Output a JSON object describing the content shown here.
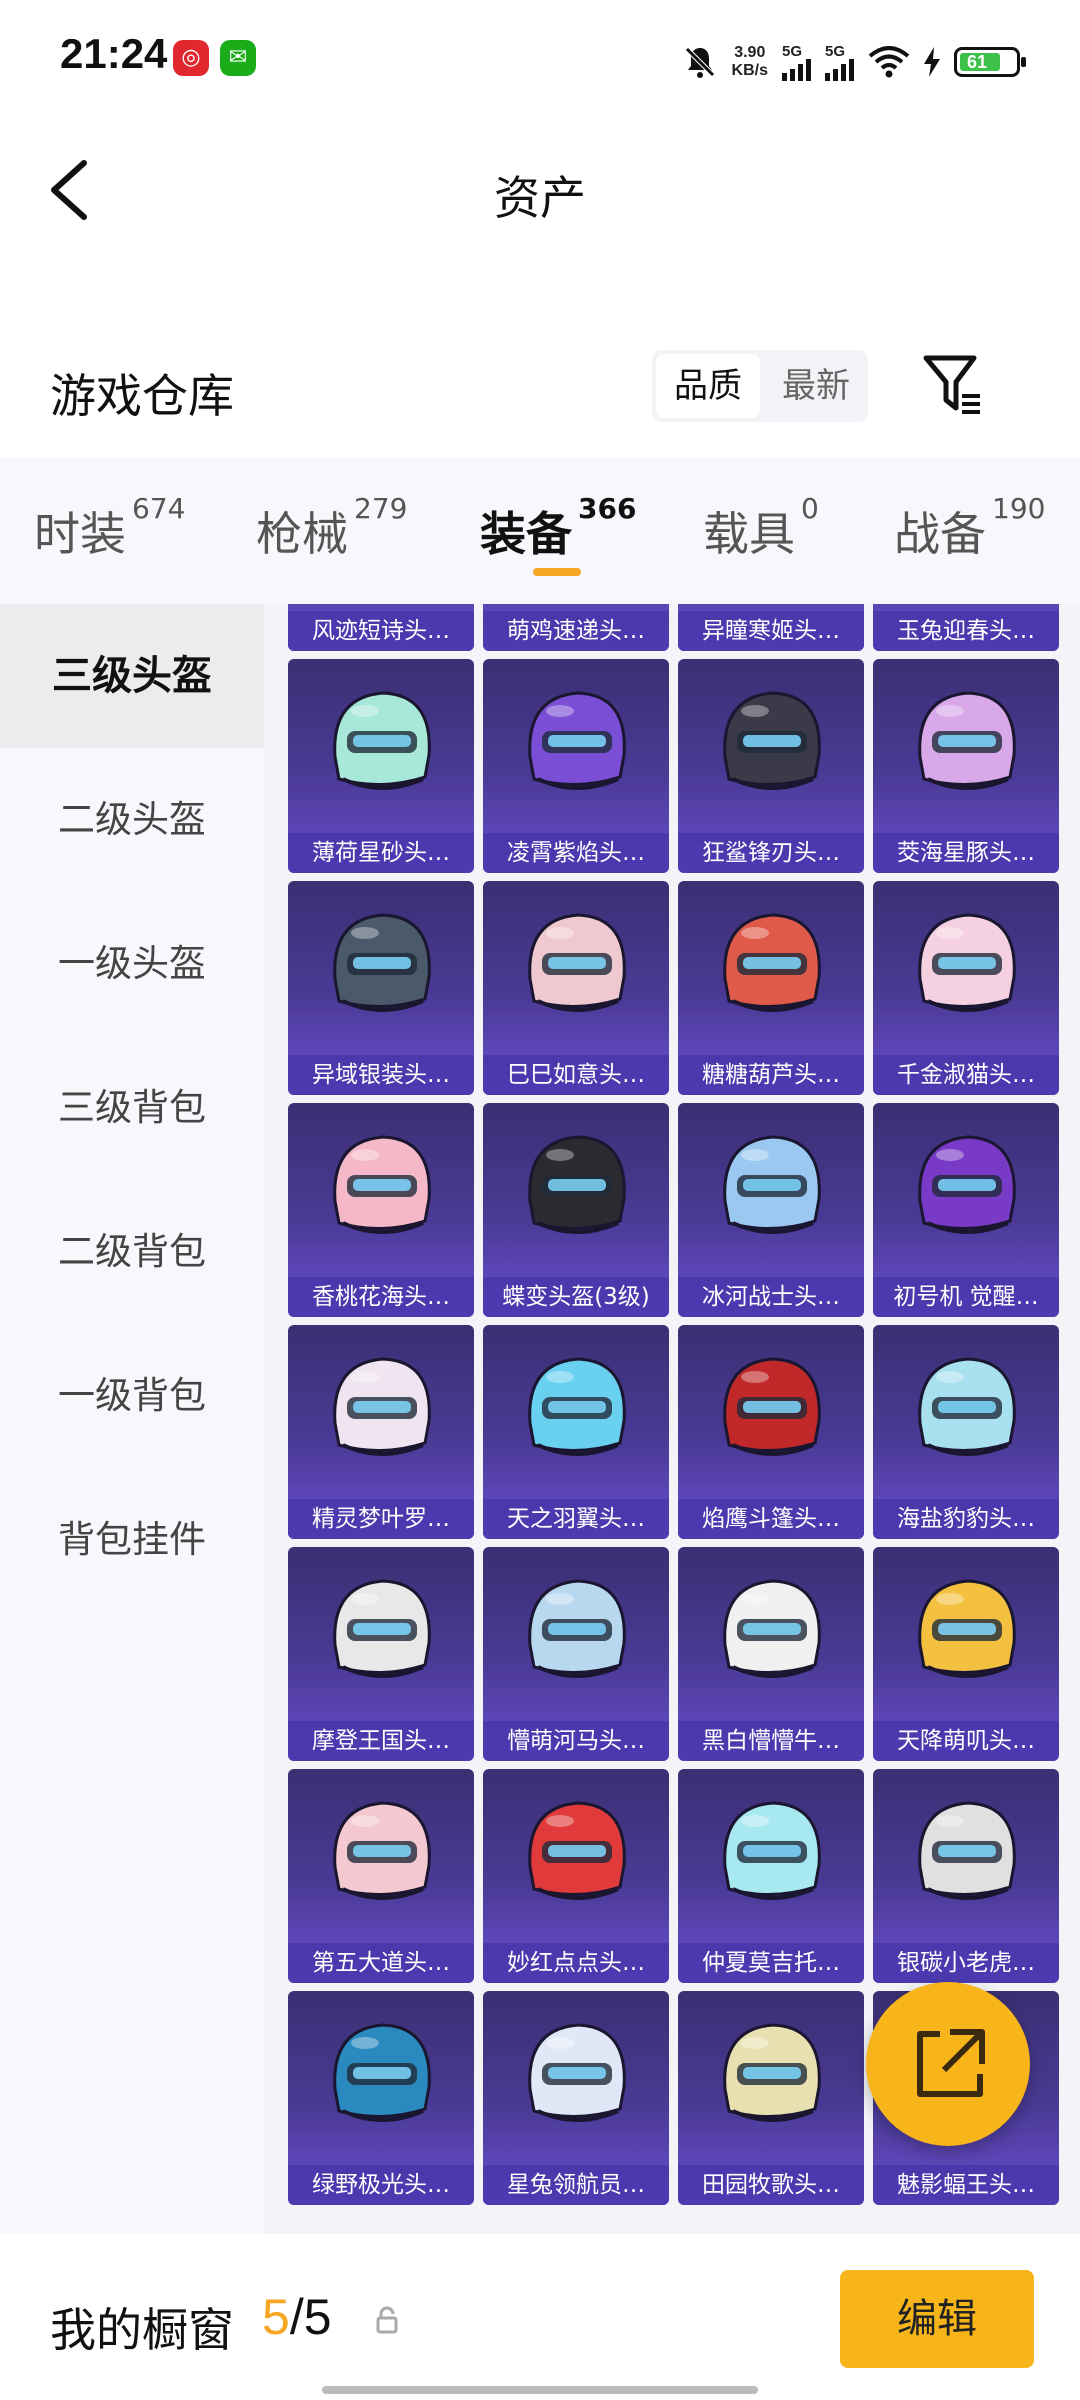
{
  "status_bar": {
    "time": "21:24",
    "net_speed_value": "3.90",
    "net_speed_unit": "KB/s",
    "signal1": "5G",
    "signal2": "5G",
    "battery": "61",
    "icons": [
      "netease-music-icon",
      "wechat-icon",
      "mute-bell-icon",
      "signal-icon",
      "signal-icon",
      "wifi-icon",
      "charging-icon",
      "battery-icon"
    ]
  },
  "header": {
    "title": "资产",
    "back_icon": "chevron-left-icon"
  },
  "warehouse": {
    "title": "游戏仓库",
    "sort": [
      "品质",
      "最新"
    ],
    "sort_active": "品质",
    "filter_icon": "filter-icon"
  },
  "tabs": [
    {
      "label": "时装",
      "count": "674"
    },
    {
      "label": "枪械",
      "count": "279"
    },
    {
      "label": "装备",
      "count": "366"
    },
    {
      "label": "载具",
      "count": "0"
    },
    {
      "label": "战备",
      "count": "190"
    }
  ],
  "tab_active": "装备",
  "sidebar": [
    "三级头盔",
    "二级头盔",
    "一级头盔",
    "三级背包",
    "二级背包",
    "一级背包",
    "背包挂件"
  ],
  "sidebar_active": "三级头盔",
  "partial_row": [
    "风迹短诗头…",
    "萌鸡速递头…",
    "异瞳寒姬头…",
    "玉兔迎春头…"
  ],
  "items": [
    {
      "name": "薄荷星砂头…",
      "color": "#a8e8d8"
    },
    {
      "name": "凌霄紫焰头…",
      "color": "#7a4fd6"
    },
    {
      "name": "狂鲨锋刃头…",
      "color": "#3a3a48"
    },
    {
      "name": "茭海星豚头…",
      "color": "#d8a8e8"
    },
    {
      "name": "异域银装头…",
      "color": "#4a5a6a"
    },
    {
      "name": "巳巳如意头…",
      "color": "#f0c8d0"
    },
    {
      "name": "糖糖葫芦头…",
      "color": "#e05a4a"
    },
    {
      "name": "千金淑猫头…",
      "color": "#f4d0e0"
    },
    {
      "name": "香桃花海头…",
      "color": "#f4b8c8"
    },
    {
      "name": "蝶变头盔(3级)",
      "color": "#2a2a30"
    },
    {
      "name": "冰河战士头…",
      "color": "#9ac8f0"
    },
    {
      "name": "初号机 觉醒…",
      "color": "#7a3ac8"
    },
    {
      "name": "精灵梦叶罗…",
      "color": "#f0e4f0"
    },
    {
      "name": "天之羽翼头…",
      "color": "#6ad0f0"
    },
    {
      "name": "焰鹰斗篷头…",
      "color": "#c0282a"
    },
    {
      "name": "海盐豹豹头…",
      "color": "#a8e0f0"
    },
    {
      "name": "摩登王国头…",
      "color": "#e8e8e8"
    },
    {
      "name": "懵萌河马头…",
      "color": "#b8d8f0"
    },
    {
      "name": "黑白懵懵牛…",
      "color": "#f0f0f0"
    },
    {
      "name": "天降萌叽头…",
      "color": "#f4c040"
    },
    {
      "name": "第五大道头…",
      "color": "#f4c8d0"
    },
    {
      "name": "妙红点点头…",
      "color": "#e03a3a"
    },
    {
      "name": "仲夏莫吉托…",
      "color": "#a8e8f0"
    },
    {
      "name": "银碳小老虎…",
      "color": "#e0e0e0"
    },
    {
      "name": "绿野极光头…",
      "color": "#2a8ac0"
    },
    {
      "name": "星兔领航员…",
      "color": "#e0e8f8"
    },
    {
      "name": "田园牧歌头…",
      "color": "#e8e0b0"
    },
    {
      "name": "魅影蝠王头…",
      "color": "#3a3a58"
    }
  ],
  "fab_icon": "share-external-icon",
  "bottom": {
    "label": "我的橱窗",
    "current": "5",
    "separator": "/",
    "total": "5",
    "lock_icon": "lock-icon",
    "edit": "编辑"
  }
}
